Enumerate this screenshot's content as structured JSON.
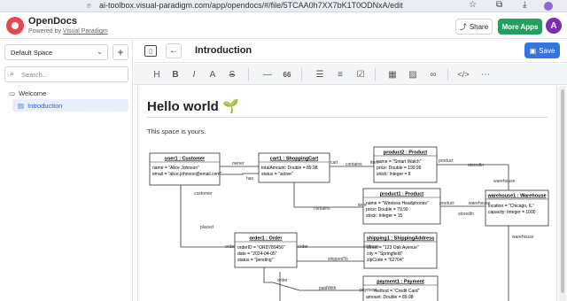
{
  "browser": {
    "url": "ai-toolbox.visual-paradigm.com/app/opendocs/#/file/5TCAA0h7XX7bK1T0ODNxA/edit"
  },
  "app": {
    "name": "OpenDocs",
    "powered_prefix": "Powered by ",
    "powered_link": "Visual Paradigm",
    "share_label": "Share",
    "more_apps_label": "More Apps",
    "avatar_letter": "A"
  },
  "sidebar": {
    "space_label": "Default Space",
    "add_label": "+",
    "search_placeholder": "Search...",
    "folder": "Welcome",
    "page": "Introduction"
  },
  "doc": {
    "title": "Introduction",
    "save_label": "Save",
    "heading": "Hello world 🌱",
    "paragraph": "This space is yours."
  },
  "toolbar": {
    "items": [
      "H",
      "B",
      "I",
      "A",
      "S",
      "—",
      "66",
      "list",
      "ordered-list",
      "check-list",
      "table",
      "image",
      "link",
      "code",
      "more"
    ]
  },
  "diagram": {
    "objects": [
      {
        "id": "user1",
        "title": "user1 : Customer",
        "attrs": [
          "name = \"Alice Johnson\"",
          "email = \"alice.johnson@email.com\""
        ]
      },
      {
        "id": "cart1",
        "title": "cart1 : ShoppingCart",
        "attrs": [
          "totalAmount: Double = 89.98",
          "status = \"active\""
        ]
      },
      {
        "id": "product2",
        "title": "product2 : Product",
        "attrs": [
          "name = \"Smart Watch\"",
          "price: Double = 199.99",
          "stock: Integer = 8"
        ]
      },
      {
        "id": "product1",
        "title": "product1 : Product",
        "attrs": [
          "name = \"Wireless Headphones\"",
          "price: Double = 79.99",
          "stock: Integer = 15"
        ]
      },
      {
        "id": "warehouse1",
        "title": "warehouse1 : Warehouse",
        "attrs": [
          "location = \"Chicago, IL\"",
          "capacity: Integer = 1000"
        ]
      },
      {
        "id": "order1",
        "title": "order1 : Order",
        "attrs": [
          "orderID = \"ORD789456\"",
          "date = \"2024-04-05\"",
          "status = \"pending\""
        ]
      },
      {
        "id": "shipping1",
        "title": "shipping1 : ShippingAddress",
        "attrs": [
          "street = \"123 Oak Avenue\"",
          "city = \"Springfield\"",
          "zipCode = \"62704\""
        ]
      },
      {
        "id": "payment1",
        "title": "payment1 : Payment",
        "attrs": [
          "method = \"Credit Card\"",
          "amount: Double = 89.98"
        ]
      }
    ],
    "labels": {
      "owner": "owner",
      "has": "has",
      "cart": "cart",
      "contains1": "contains",
      "item1": "item",
      "product1": "product",
      "storedIn1": "storedIn",
      "contains2": "contains",
      "item2": "item",
      "product2": "product",
      "storedIn2": "storedIn",
      "warehouse1": "warehouse",
      "warehouse2": "warehouse",
      "customer": "customer",
      "placed": "placed",
      "order1": "order",
      "order2": "order",
      "address": "address",
      "shippedTo": "shippedTo",
      "order3": "order",
      "paidWith": "paidWith",
      "payment": "payment"
    }
  }
}
